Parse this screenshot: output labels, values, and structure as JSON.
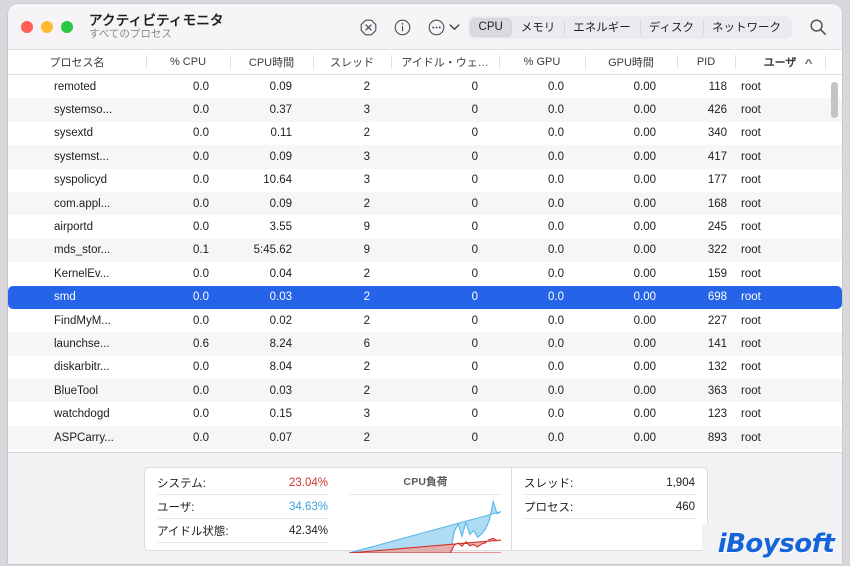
{
  "window": {
    "title": "アクティビティモニタ",
    "subtitle": "すべてのプロセス"
  },
  "toolbar": {
    "stop_icon": "stop-process-icon",
    "info_icon": "info-icon",
    "more_icon": "more-options-icon",
    "chevron_icon": "chevron-down-icon",
    "search_icon": "search-icon",
    "tabs": [
      {
        "label": "CPU",
        "active": true
      },
      {
        "label": "メモリ",
        "active": false
      },
      {
        "label": "エネルギー",
        "active": false
      },
      {
        "label": "ディスク",
        "active": false
      },
      {
        "label": "ネットワーク",
        "active": false
      }
    ]
  },
  "table": {
    "columns": [
      {
        "label": "プロセス名",
        "key": "name",
        "cls": "c-name"
      },
      {
        "label": "% CPU",
        "key": "cpu",
        "cls": "c-cpu"
      },
      {
        "label": "CPU時間",
        "key": "cputime",
        "cls": "c-time"
      },
      {
        "label": "スレッド",
        "key": "threads",
        "cls": "c-thr"
      },
      {
        "label": "アイドル・ウェ…",
        "key": "idlewake",
        "cls": "c-idle"
      },
      {
        "label": "% GPU",
        "key": "gpu",
        "cls": "c-gpu"
      },
      {
        "label": "GPU時間",
        "key": "gputime",
        "cls": "c-gtime"
      },
      {
        "label": "PID",
        "key": "pid",
        "cls": "c-pid"
      },
      {
        "label": "ユーザ",
        "key": "user",
        "cls": "c-user",
        "sorted": true
      }
    ],
    "sort_indicator": "︿",
    "rows": [
      {
        "name": "remoted",
        "cpu": "0.0",
        "cputime": "0.09",
        "threads": "2",
        "idlewake": "0",
        "gpu": "0.0",
        "gputime": "0.00",
        "pid": "118",
        "user": "root",
        "selected": false
      },
      {
        "name": "systemso...",
        "cpu": "0.0",
        "cputime": "0.37",
        "threads": "3",
        "idlewake": "0",
        "gpu": "0.0",
        "gputime": "0.00",
        "pid": "426",
        "user": "root",
        "selected": false
      },
      {
        "name": "sysextd",
        "cpu": "0.0",
        "cputime": "0.11",
        "threads": "2",
        "idlewake": "0",
        "gpu": "0.0",
        "gputime": "0.00",
        "pid": "340",
        "user": "root",
        "selected": false
      },
      {
        "name": "systemst...",
        "cpu": "0.0",
        "cputime": "0.09",
        "threads": "3",
        "idlewake": "0",
        "gpu": "0.0",
        "gputime": "0.00",
        "pid": "417",
        "user": "root",
        "selected": false
      },
      {
        "name": "syspolicyd",
        "cpu": "0.0",
        "cputime": "10.64",
        "threads": "3",
        "idlewake": "0",
        "gpu": "0.0",
        "gputime": "0.00",
        "pid": "177",
        "user": "root",
        "selected": false
      },
      {
        "name": "com.appl...",
        "cpu": "0.0",
        "cputime": "0.09",
        "threads": "2",
        "idlewake": "0",
        "gpu": "0.0",
        "gputime": "0.00",
        "pid": "168",
        "user": "root",
        "selected": false
      },
      {
        "name": "airportd",
        "cpu": "0.0",
        "cputime": "3.55",
        "threads": "9",
        "idlewake": "0",
        "gpu": "0.0",
        "gputime": "0.00",
        "pid": "245",
        "user": "root",
        "selected": false
      },
      {
        "name": "mds_stor...",
        "cpu": "0.1",
        "cputime": "5:45.62",
        "threads": "9",
        "idlewake": "0",
        "gpu": "0.0",
        "gputime": "0.00",
        "pid": "322",
        "user": "root",
        "selected": false
      },
      {
        "name": "KernelEv...",
        "cpu": "0.0",
        "cputime": "0.04",
        "threads": "2",
        "idlewake": "0",
        "gpu": "0.0",
        "gputime": "0.00",
        "pid": "159",
        "user": "root",
        "selected": false
      },
      {
        "name": "smd",
        "cpu": "0.0",
        "cputime": "0.03",
        "threads": "2",
        "idlewake": "0",
        "gpu": "0.0",
        "gputime": "0.00",
        "pid": "698",
        "user": "root",
        "selected": true
      },
      {
        "name": "FindMyM...",
        "cpu": "0.0",
        "cputime": "0.02",
        "threads": "2",
        "idlewake": "0",
        "gpu": "0.0",
        "gputime": "0.00",
        "pid": "227",
        "user": "root",
        "selected": false
      },
      {
        "name": "launchse...",
        "cpu": "0.6",
        "cputime": "8.24",
        "threads": "6",
        "idlewake": "0",
        "gpu": "0.0",
        "gputime": "0.00",
        "pid": "141",
        "user": "root",
        "selected": false
      },
      {
        "name": "diskarbitr...",
        "cpu": "0.0",
        "cputime": "8.04",
        "threads": "2",
        "idlewake": "0",
        "gpu": "0.0",
        "gputime": "0.00",
        "pid": "132",
        "user": "root",
        "selected": false
      },
      {
        "name": "BlueTool",
        "cpu": "0.0",
        "cputime": "0.03",
        "threads": "2",
        "idlewake": "0",
        "gpu": "0.0",
        "gputime": "0.00",
        "pid": "363",
        "user": "root",
        "selected": false
      },
      {
        "name": "watchdogd",
        "cpu": "0.0",
        "cputime": "0.15",
        "threads": "3",
        "idlewake": "0",
        "gpu": "0.0",
        "gputime": "0.00",
        "pid": "123",
        "user": "root",
        "selected": false
      },
      {
        "name": "ASPCarry...",
        "cpu": "0.0",
        "cputime": "0.07",
        "threads": "2",
        "idlewake": "0",
        "gpu": "0.0",
        "gputime": "0.00",
        "pid": "893",
        "user": "root",
        "selected": false
      }
    ]
  },
  "footer": {
    "cpu_stats": [
      {
        "label": "システム:",
        "value": "23.04%",
        "color_class": "sys"
      },
      {
        "label": "ユーザ:",
        "value": "34.63%",
        "color_class": "user"
      },
      {
        "label": "アイドル状態:",
        "value": "42.34%",
        "color_class": ""
      }
    ],
    "load_title": "CPU負荷",
    "counts": [
      {
        "label": "スレッド:",
        "value": "1,904"
      },
      {
        "label": "プロセス:",
        "value": "460"
      }
    ],
    "watermark": "iBoysoft"
  },
  "colors": {
    "selection": "#2563e8",
    "system": "#d0342c",
    "user": "#3aa0e0",
    "watermark": "#1466d8"
  },
  "chart_data": {
    "type": "area",
    "title": "CPU負荷",
    "xlabel": "",
    "ylabel": "",
    "ylim": [
      0,
      100
    ],
    "grid": false,
    "legend_position": "none",
    "x": [
      0,
      1,
      2,
      3,
      4,
      5,
      6,
      7,
      8,
      9,
      10,
      11,
      12,
      13,
      14,
      15,
      16,
      17,
      18,
      19,
      20,
      21,
      22,
      23,
      24,
      25,
      26,
      27,
      28,
      29,
      30,
      31,
      32,
      33,
      34,
      35,
      36,
      37,
      38,
      39
    ],
    "series": [
      {
        "name": "ユーザ",
        "color": "#7ec8ef",
        "values": [
          0,
          0,
          0,
          0,
          0,
          0,
          0,
          0,
          0,
          0,
          0,
          0,
          0,
          0,
          0,
          0,
          0,
          0,
          0,
          0,
          0,
          0,
          0,
          0,
          0,
          0,
          0,
          38,
          52,
          30,
          55,
          33,
          40,
          28,
          34,
          42,
          58,
          92,
          70,
          74
        ]
      },
      {
        "name": "システム",
        "color": "#d0342c",
        "values": [
          0,
          0,
          0,
          0,
          0,
          0,
          0,
          0,
          0,
          0,
          0,
          0,
          0,
          0,
          0,
          0,
          0,
          0,
          0,
          0,
          0,
          0,
          0,
          0,
          0,
          0,
          0,
          14,
          18,
          12,
          20,
          13,
          15,
          11,
          16,
          18,
          24,
          26,
          22,
          23
        ]
      }
    ]
  }
}
